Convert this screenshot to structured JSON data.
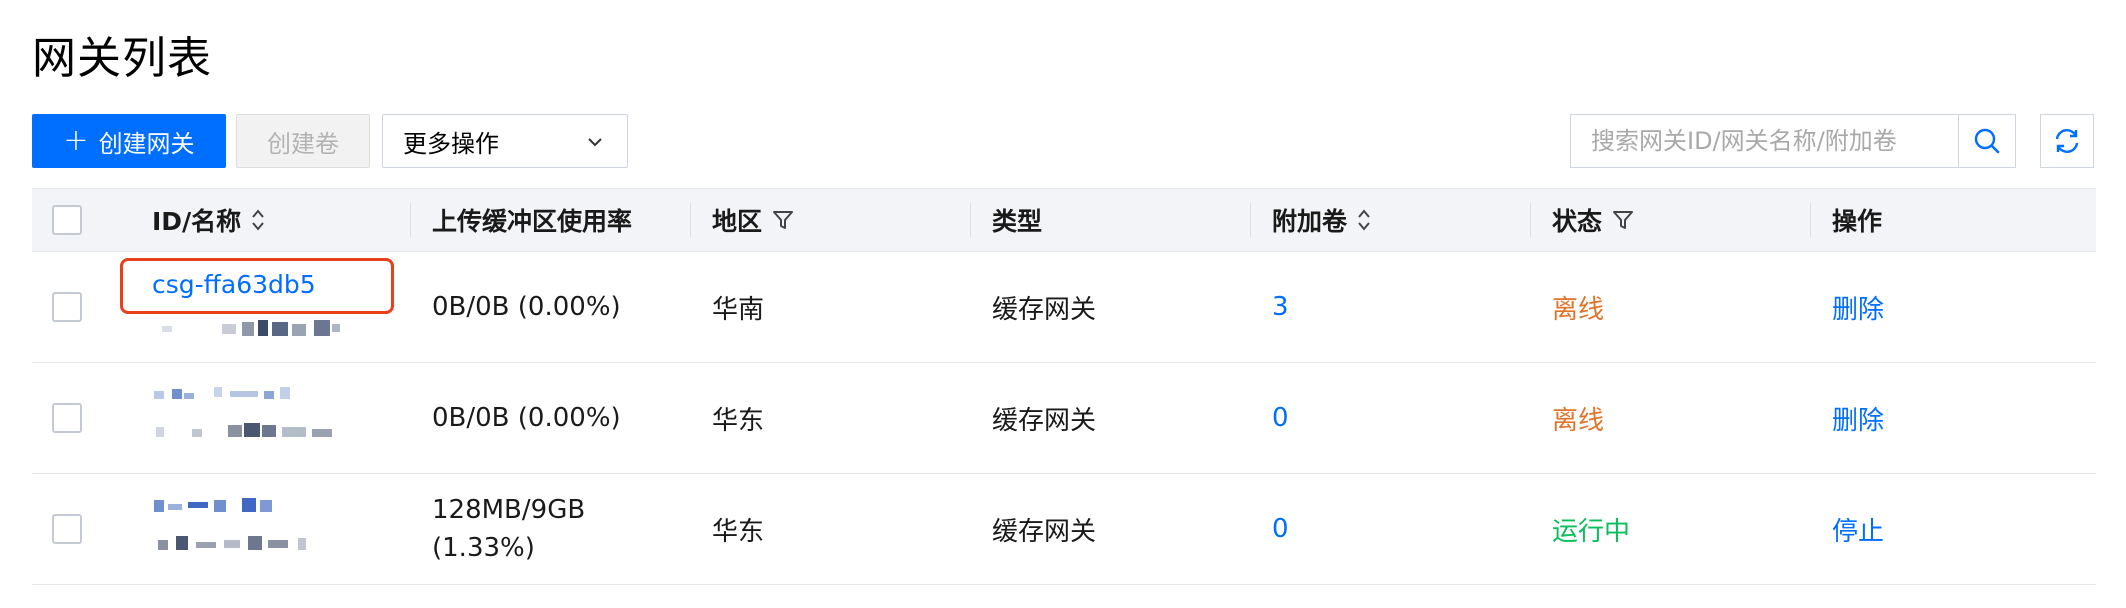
{
  "page": {
    "title": "网关列表"
  },
  "toolbar": {
    "create_gateway": "创建网关",
    "create_volume": "创建卷",
    "more_actions": "更多操作",
    "search_placeholder": "搜索网关ID/网关名称/附加卷"
  },
  "icons": {
    "plus": "plus-icon",
    "chevron": "chevron-down-icon",
    "search": "search-icon",
    "refresh": "refresh-icon",
    "sort": "sort-icon",
    "filter": "filter-icon"
  },
  "colors": {
    "primary": "#006eff",
    "offline": "#e1742b",
    "running": "#0abf5b",
    "highlight": "#e8401c"
  },
  "table": {
    "headers": {
      "id_name": "ID/名称",
      "upload_buffer": "上传缓冲区使用率",
      "region": "地区",
      "type": "类型",
      "volumes": "附加卷",
      "status": "状态",
      "actions": "操作"
    },
    "rows": [
      {
        "id": "csg-ffa63db5",
        "usage": "0B/0B (0.00%)",
        "region": "华南",
        "type": "缓存网关",
        "volumes": "3",
        "status": "离线",
        "action": "删除"
      },
      {
        "id": "",
        "usage": "0B/0B (0.00%)",
        "region": "华东",
        "type": "缓存网关",
        "volumes": "0",
        "status": "离线",
        "action": "删除"
      },
      {
        "id": "",
        "usage_line1": "128MB/9GB",
        "usage_line2": "(1.33%)",
        "region": "华东",
        "type": "缓存网关",
        "volumes": "0",
        "status": "运行中",
        "action": "停止"
      }
    ]
  }
}
